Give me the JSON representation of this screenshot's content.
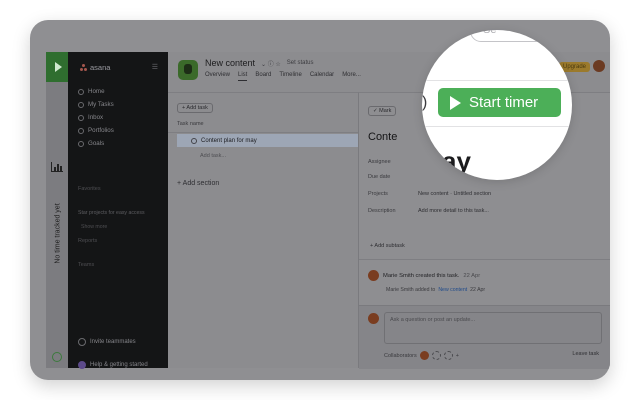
{
  "tracker": {
    "vertical_label": "No time tracked yet",
    "play_icon": "play-icon",
    "chart_icon": "bar-chart-icon"
  },
  "sidebar": {
    "brand": "asana",
    "items": [
      {
        "label": "Home",
        "icon": "home-icon"
      },
      {
        "label": "My Tasks",
        "icon": "check-circle-icon"
      },
      {
        "label": "Inbox",
        "icon": "inbox-icon"
      },
      {
        "label": "Portfolios",
        "icon": "portfolio-icon"
      },
      {
        "label": "Goals",
        "icon": "goal-icon"
      }
    ],
    "favorites_heading": "Favorites",
    "favorites_hint": "Star projects for easy access",
    "show_more": "Show more",
    "reports_heading": "Reports",
    "teams_heading": "Teams",
    "invite_label": "Invite teammates",
    "help_label": "Help & getting started"
  },
  "header": {
    "project_title": "New content",
    "set_status": "Set status",
    "tabs": [
      "Overview",
      "List",
      "Board",
      "Timeline",
      "Calendar",
      "More..."
    ],
    "active_tab": "List",
    "upgrade_label": "Upgrade"
  },
  "list": {
    "add_task": "+ Add task",
    "column_task_name": "Task name",
    "task": "Content plan for may",
    "add_task_link": "Add task...",
    "add_section": "+ Add section"
  },
  "detail": {
    "mark_complete": "✓ Mark",
    "title": "Conte",
    "fields": [
      {
        "label": "Assignee",
        "value": ""
      },
      {
        "label": "Due date",
        "value": ""
      },
      {
        "label": "Projects",
        "value": "New content · Untitled section"
      },
      {
        "label": "Description",
        "value": "Add more detail to this task..."
      }
    ],
    "add_subtask": "+ Add subtask",
    "activity_main": "Marie Smith created this task.",
    "activity_time": "22 Apr",
    "activity_sub_prefix": "Marie Smith added to",
    "activity_sub_link": "New content",
    "activity_sub_time": "22 Apr",
    "comment_placeholder": "Ask a question or post an update...",
    "collaborators_label": "Collaborators",
    "leave_task": "Leave task"
  },
  "magnifier": {
    "search_text": "Se",
    "start_timer_label": "Start timer",
    "big_text_fragment": "ay",
    "edge_fragment": ")"
  }
}
